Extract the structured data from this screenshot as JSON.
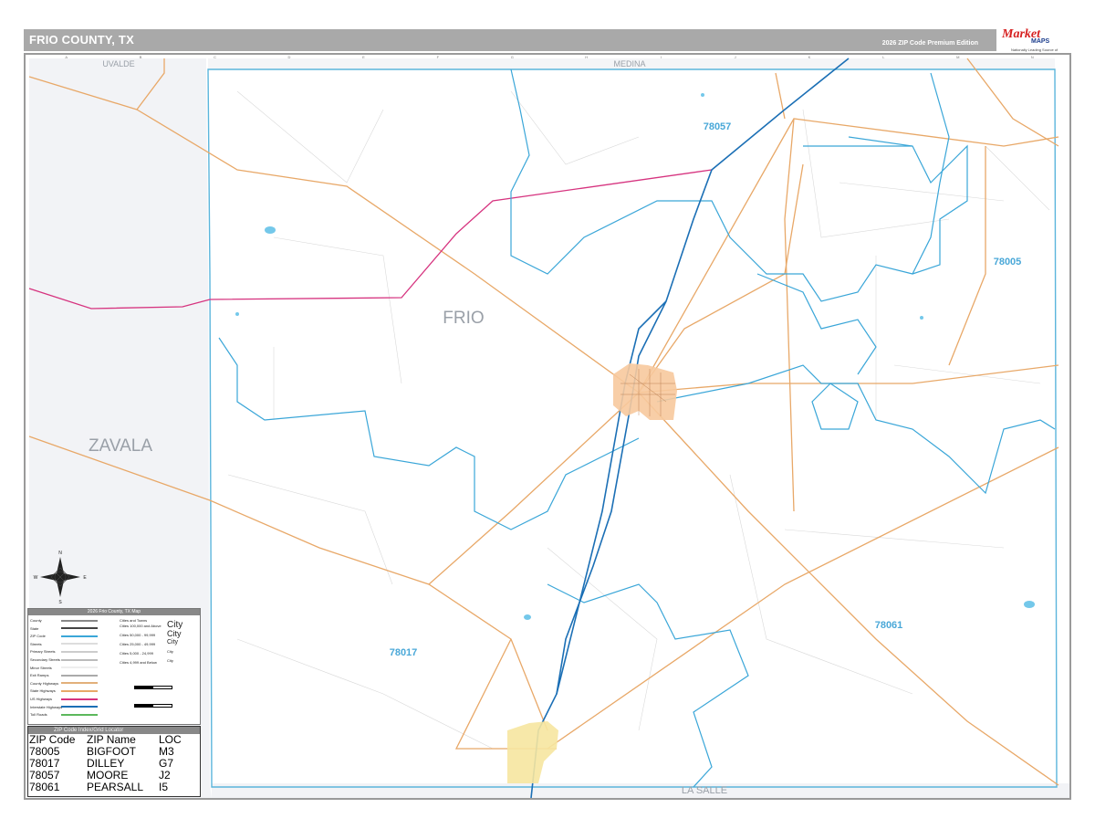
{
  "header": {
    "title": "FRIO COUNTY, TX",
    "edition": "2026 ZIP Code Premium Edition"
  },
  "logo": {
    "brand_main": "Market",
    "brand_maps": "MAPS",
    "tagline": "Nationally Leading Source of Business Maps"
  },
  "map": {
    "county_label": "FRIO",
    "neighbor_counties": {
      "north_west": "UVALDE",
      "north": "MEDINA",
      "west": "ZAVALA",
      "south": "LA SALLE"
    },
    "zip_labels": [
      "78057",
      "78005",
      "78061",
      "78017"
    ],
    "grid_columns": [
      "A",
      "B",
      "C",
      "D",
      "E",
      "F",
      "G",
      "H",
      "I",
      "J",
      "K",
      "L",
      "M",
      "N"
    ],
    "colors": {
      "zip_boundary": "#3aa6d8",
      "interstate": "#1b6fb5",
      "us_highway": "#d6337f",
      "state_highway": "#e8a868",
      "city_fill": "#f7c99d",
      "city_fill_south": "#f6e6a0",
      "neighbor_fill": "#f2f3f6",
      "zip_label": "#4aa8d8"
    }
  },
  "compass": {
    "n": "N",
    "s": "S",
    "e": "E",
    "w": "W"
  },
  "legend": {
    "title": "2026 Frio County, TX Map",
    "rows": [
      "County",
      "State",
      "ZIP Code",
      "Streets",
      "Primary Streets",
      "Secondary Streets",
      "Minor Streets",
      "Exit Ramps",
      "County Highways",
      "State Highways",
      "US Highways",
      "Interstate Highways",
      "Toll Roads"
    ],
    "cities_header": "Cities and Towns",
    "city_sizes": [
      "Cities 100,000 and Above",
      "Cities 50,000 - 99,999",
      "Cities 25,000 - 49,999",
      "Cities 5,000 - 24,999",
      "Cities 4,999 and Below"
    ],
    "city_samples": [
      "City",
      "City",
      "City",
      "City",
      "City"
    ]
  },
  "zip_table": {
    "title": "ZIP Code Index/Grid Locator",
    "headers": [
      "ZIP Code",
      "ZIP Name",
      "LOC"
    ],
    "rows": [
      [
        "78005",
        "BIGFOOT",
        "M3"
      ],
      [
        "78017",
        "DILLEY",
        "G7"
      ],
      [
        "78057",
        "MOORE",
        "J2"
      ],
      [
        "78061",
        "PEARSALL",
        "I5"
      ]
    ]
  }
}
